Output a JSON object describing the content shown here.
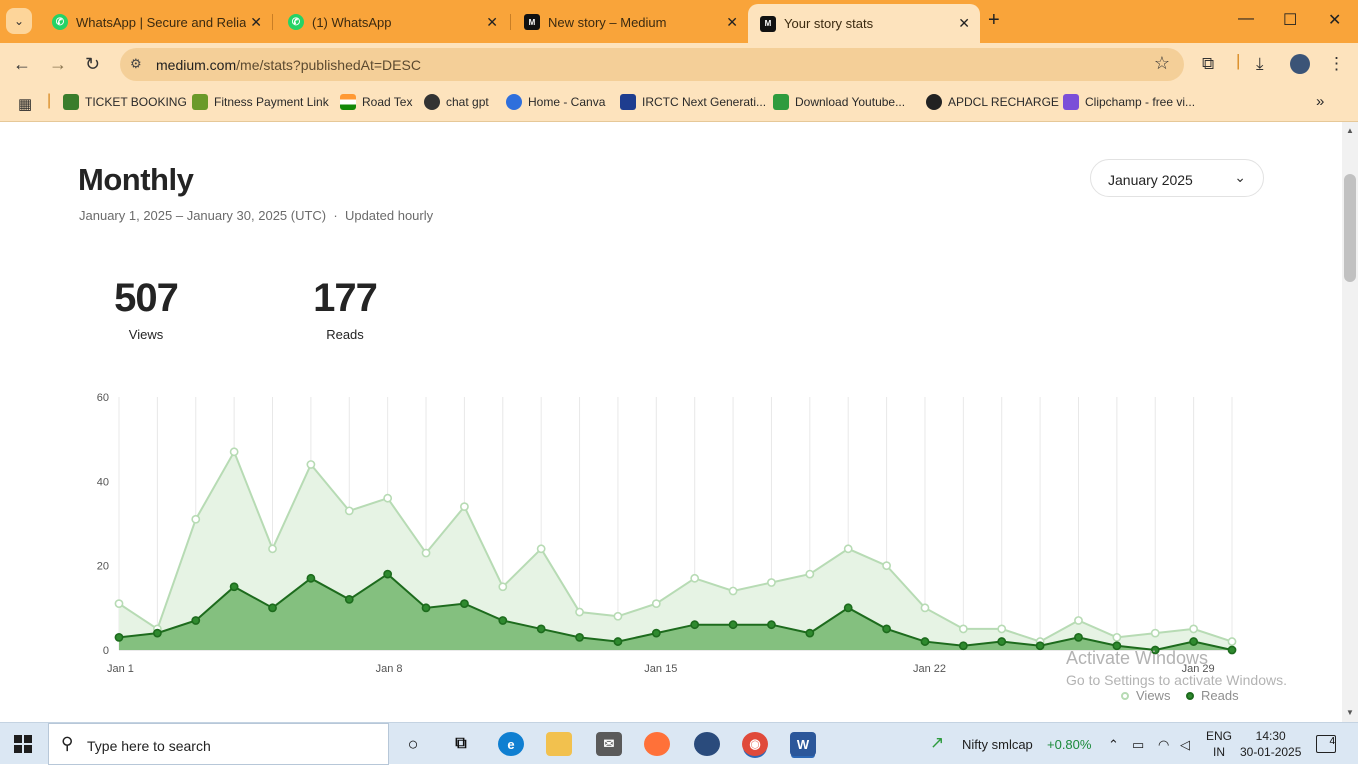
{
  "browser": {
    "tabs": [
      {
        "title": "WhatsApp | Secure and Reliable",
        "icon": "whatsapp-icon"
      },
      {
        "title": "(1) WhatsApp",
        "icon": "whatsapp-icon"
      },
      {
        "title": "New story – Medium",
        "icon": "medium-icon"
      },
      {
        "title": "Your story stats",
        "icon": "medium-icon",
        "active": true
      }
    ],
    "url_host": "medium.com",
    "url_path": "/me/stats?publishedAt=DESC",
    "bookmarks": [
      {
        "label": "TICKET BOOKING",
        "color": "#3a7d2c"
      },
      {
        "label": "Fitness Payment Link",
        "color": "#6a9a2a"
      },
      {
        "label": "Road Tex",
        "color": "#ff9933"
      },
      {
        "label": "chat gpt",
        "color": "#333333"
      },
      {
        "label": "Home - Canva",
        "color": "#2f6fdc"
      },
      {
        "label": "IRCTC Next Generati...",
        "color": "#1e3d8f"
      },
      {
        "label": "Download Youtube...",
        "color": "#2e9b3e"
      },
      {
        "label": "APDCL RECHARGE",
        "color": "#222222"
      },
      {
        "label": "Clipchamp - free vi...",
        "color": "#7b4fd8"
      }
    ]
  },
  "page": {
    "title": "Monthly",
    "subtitle": "January 1, 2025 – January 30, 2025 (UTC)",
    "subtitle_sep": "·",
    "updated": "Updated hourly",
    "month_select": "January 2025",
    "stats": [
      {
        "value": "507",
        "label": "Views"
      },
      {
        "value": "177",
        "label": "Reads"
      }
    ]
  },
  "chart_data": {
    "type": "area",
    "x": [
      "Jan 1",
      "Jan 2",
      "Jan 3",
      "Jan 4",
      "Jan 5",
      "Jan 6",
      "Jan 7",
      "Jan 8",
      "Jan 9",
      "Jan 10",
      "Jan 11",
      "Jan 12",
      "Jan 13",
      "Jan 14",
      "Jan 15",
      "Jan 16",
      "Jan 17",
      "Jan 18",
      "Jan 19",
      "Jan 20",
      "Jan 21",
      "Jan 22",
      "Jan 23",
      "Jan 24",
      "Jan 25",
      "Jan 26",
      "Jan 27",
      "Jan 28",
      "Jan 29",
      "Jan 30"
    ],
    "x_tick_labels": [
      "Jan 1",
      "Jan 8",
      "Jan 15",
      "Jan 22",
      "Jan 29"
    ],
    "x_tick_indices": [
      0,
      7,
      14,
      21,
      28
    ],
    "series": [
      {
        "name": "Views",
        "color": "#b7dbb4",
        "fill": "#e6f3e4",
        "values": [
          11,
          5,
          31,
          47,
          24,
          44,
          33,
          36,
          23,
          34,
          15,
          24,
          9,
          8,
          11,
          17,
          14,
          16,
          18,
          24,
          20,
          10,
          5,
          5,
          2,
          7,
          3,
          4,
          5,
          2
        ]
      },
      {
        "name": "Reads",
        "color": "#1d6b1d",
        "fill": "#84c07f",
        "values": [
          3,
          4,
          7,
          15,
          10,
          17,
          12,
          18,
          10,
          11,
          7,
          5,
          3,
          2,
          4,
          6,
          6,
          6,
          4,
          10,
          5,
          2,
          1,
          2,
          1,
          3,
          1,
          0,
          2,
          0
        ]
      }
    ],
    "ylim": [
      0,
      60
    ],
    "yticks": [
      0,
      20,
      40,
      60
    ],
    "grid": true,
    "legend": "bottom-right"
  },
  "watermark": {
    "line1": "Activate Windows",
    "line2": "Go to Settings to activate Windows."
  },
  "taskbar": {
    "search_placeholder": "Type here to search",
    "stock_name": "Nifty smlcap",
    "stock_change": "+0.80%",
    "lang1": "ENG",
    "lang2": "IN",
    "time": "14:30",
    "date": "30-01-2025",
    "notifications": "4"
  }
}
